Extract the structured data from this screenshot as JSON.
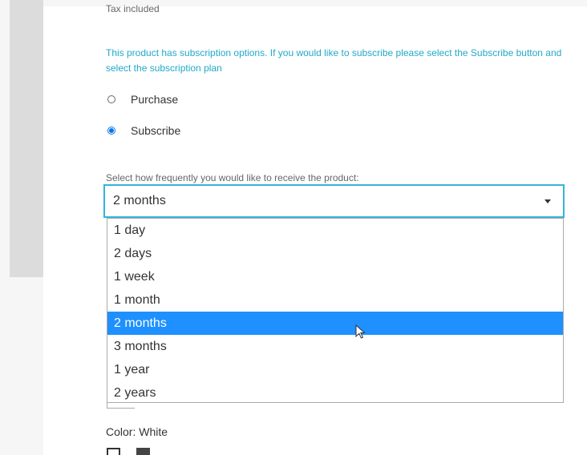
{
  "header": {
    "tax_note": "Tax included"
  },
  "subscription": {
    "info_text": "This product has subscription options. If you would like to subscribe please select the Subscribe button and select the subscription plan",
    "radio_options": [
      {
        "label": "Purchase",
        "checked": false
      },
      {
        "label": "Subscribe",
        "checked": true
      }
    ],
    "frequency_label": "Select how frequently you would like to receive the product:",
    "selected_frequency": "2 months",
    "frequency_options": [
      "1 day",
      "2 days",
      "1 week",
      "1 month",
      "2 months",
      "3 months",
      "1 year",
      "2 years"
    ],
    "selected_index": 4
  },
  "product": {
    "color_label": "Color: White",
    "swatches": [
      "white-swatch",
      "dark-gray-swatch"
    ]
  },
  "colors": {
    "accent": "#21a9c8",
    "select_border": "#34b4dd",
    "selected_option": "#1e90ff",
    "radio_checked": "#0a74e8",
    "left_panel": "#dcdcdc"
  },
  "icons": {
    "dropdown": "caret-down-icon",
    "cursor": "mouse-pointer-icon"
  }
}
